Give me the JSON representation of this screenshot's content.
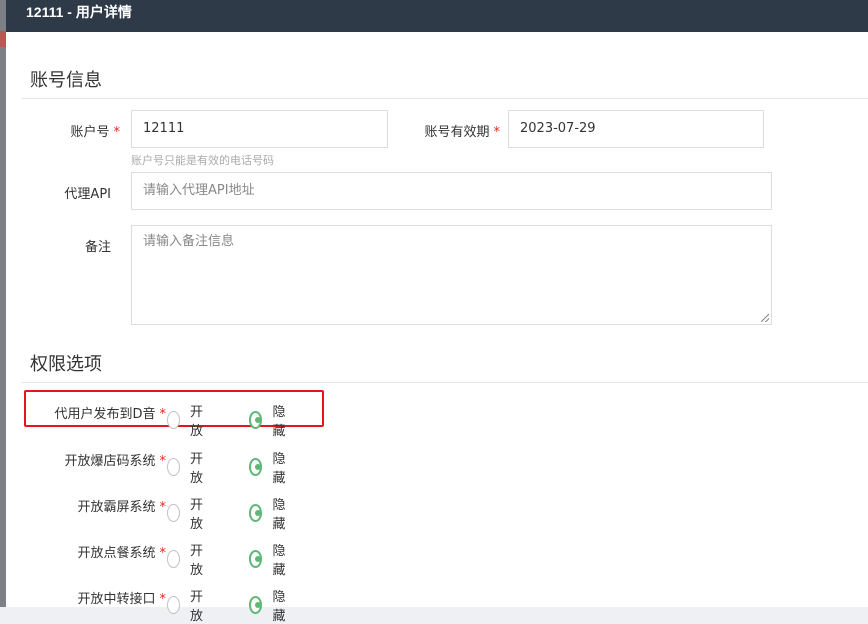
{
  "dialog": {
    "title": "12111 - 用户详情"
  },
  "account_section": {
    "title": "账号信息",
    "account_no": {
      "label": "账户号",
      "value": "12111",
      "hint": "账户号只能是有效的电话号码"
    },
    "expiry": {
      "label": "账号有效期",
      "value": "2023-07-29"
    },
    "proxy_api": {
      "label": "代理API",
      "placeholder": "请输入代理API地址"
    },
    "remark": {
      "label": "备注",
      "placeholder": "请输入备注信息"
    }
  },
  "permission_section": {
    "title": "权限选项",
    "options": [
      {
        "label": "代用户发布到D音",
        "open": "开放",
        "hidden": "隐藏",
        "selected": "hidden"
      },
      {
        "label": "开放爆店码系统",
        "open": "开放",
        "hidden": "隐藏",
        "selected": "hidden"
      },
      {
        "label": "开放霸屏系统",
        "open": "开放",
        "hidden": "隐藏",
        "selected": "hidden"
      },
      {
        "label": "开放点餐系统",
        "open": "开放",
        "hidden": "隐藏",
        "selected": "hidden"
      },
      {
        "label": "开放中转接口",
        "open": "开放",
        "hidden": "隐藏",
        "selected": "hidden"
      }
    ]
  },
  "colors": {
    "header_bg": "#2f3a48",
    "radio_checked": "#5fb878",
    "required": "#e2231a",
    "highlight": "#e4161b"
  }
}
